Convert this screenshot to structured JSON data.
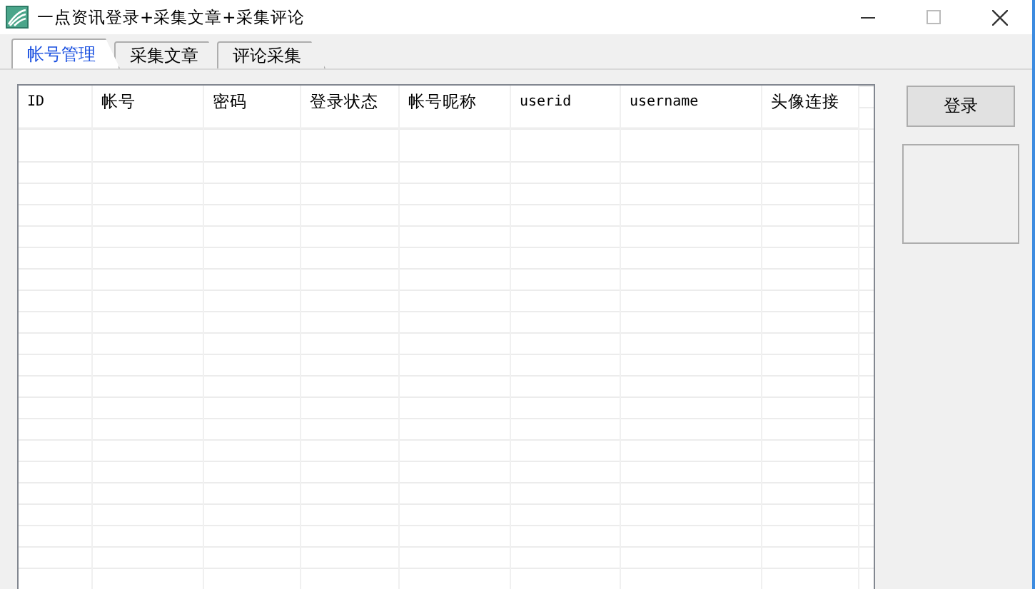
{
  "window": {
    "title": "一点资讯登录+采集文章+采集评论"
  },
  "tabs": [
    {
      "label": "帐号管理",
      "selected": true
    },
    {
      "label": "采集文章",
      "selected": false
    },
    {
      "label": "评论采集",
      "selected": false
    }
  ],
  "table": {
    "columns": [
      "ID",
      "帐号",
      "密码",
      "登录状态",
      "帐号昵称",
      "userid",
      "username",
      "头像连接"
    ]
  },
  "buttons": [
    "登录"
  ]
}
